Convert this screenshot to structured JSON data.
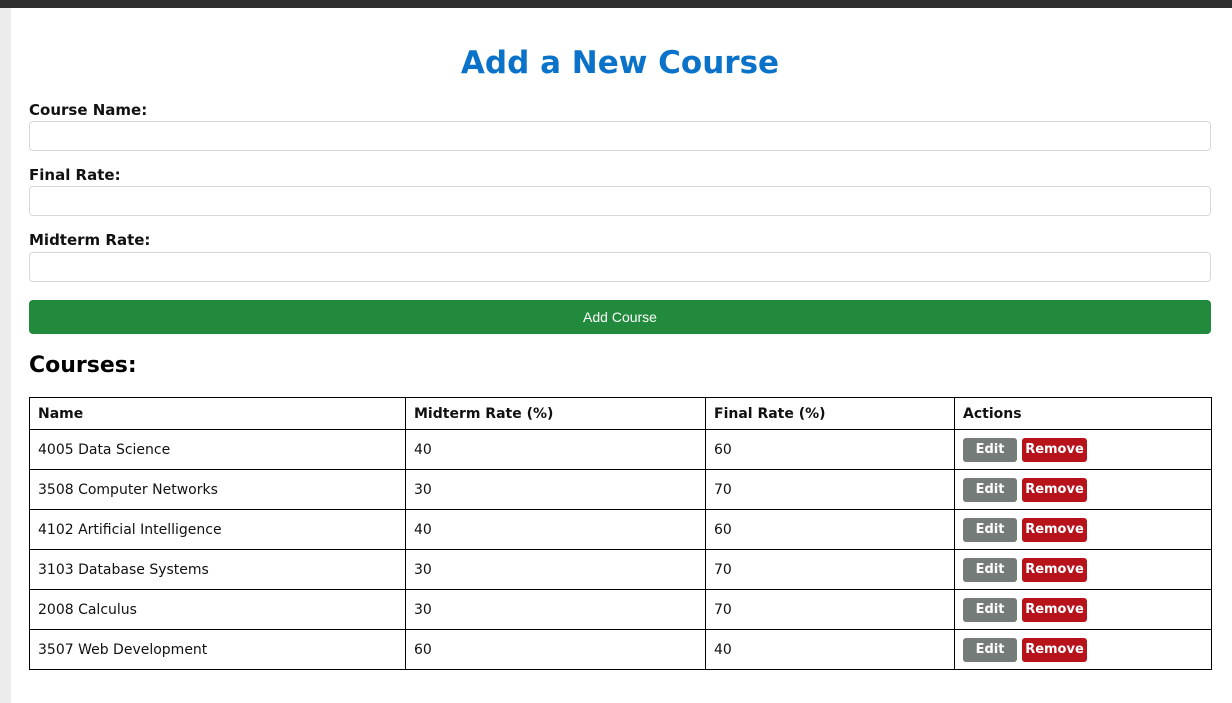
{
  "page": {
    "title": "Add a New Course"
  },
  "form": {
    "course_name_label": "Course Name:",
    "course_name_value": "",
    "final_rate_label": "Final Rate:",
    "final_rate_value": "",
    "midterm_rate_label": "Midterm Rate:",
    "midterm_rate_value": "",
    "submit_label": "Add Course"
  },
  "courses": {
    "heading": "Courses:",
    "columns": [
      "Name",
      "Midterm Rate (%)",
      "Final Rate (%)",
      "Actions"
    ],
    "edit_label": "Edit",
    "remove_label": "Remove",
    "rows": [
      {
        "name": "4005 Data Science",
        "midterm": "40",
        "final": "60"
      },
      {
        "name": "3508 Computer Networks",
        "midterm": "30",
        "final": "70"
      },
      {
        "name": "4102 Artificial Intelligence",
        "midterm": "40",
        "final": "60"
      },
      {
        "name": "3103 Database Systems",
        "midterm": "30",
        "final": "70"
      },
      {
        "name": "2008 Calculus",
        "midterm": "30",
        "final": "70"
      },
      {
        "name": "3507 Web Development",
        "midterm": "60",
        "final": "40"
      }
    ]
  },
  "colors": {
    "title": "#0a73c9",
    "add_button": "#218a3c",
    "edit_button": "#757b79",
    "remove_button": "#b8121b"
  }
}
